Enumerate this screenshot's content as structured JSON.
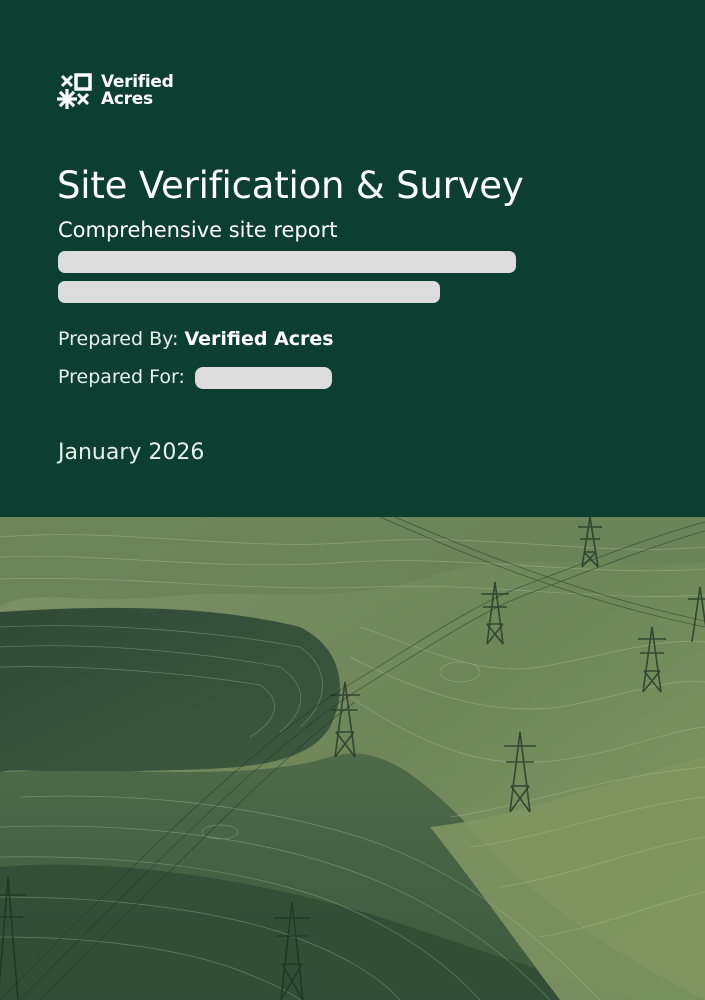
{
  "brand": {
    "line1": "Verified",
    "line2": "Acres",
    "icon": "verified-acres-logo-mark"
  },
  "cover": {
    "title": "Site Verification & Survey",
    "subtitle": "Comprehensive site report",
    "prepared_by_label": "Prepared By:",
    "prepared_by_value": "Verified Acres",
    "prepared_for_label": "Prepared For:",
    "date": "January 2026"
  },
  "colors": {
    "header_background": "#0c3f31",
    "redaction": "#dcdcdc",
    "field_dark": "#34513b",
    "field_light": "#7a8f5f"
  },
  "image": {
    "subject": "aerial-farmland-with-power-transmission-towers"
  }
}
